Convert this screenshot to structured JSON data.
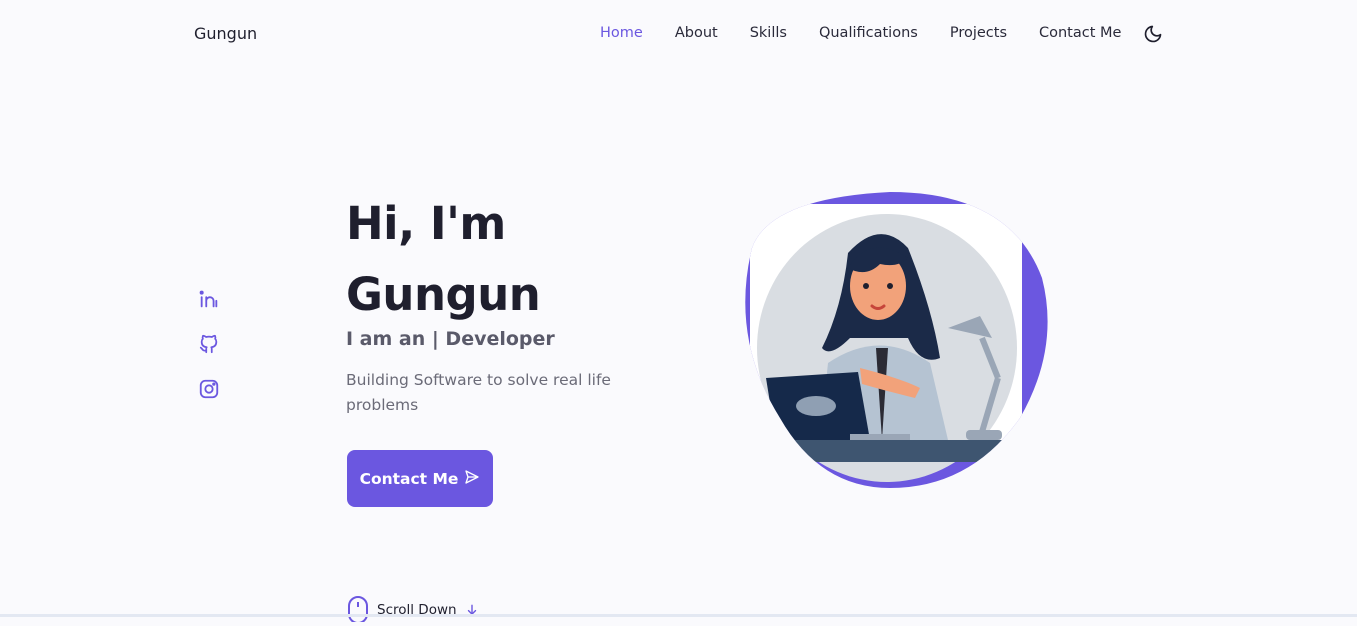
{
  "header": {
    "logo": "Gungun",
    "nav": [
      {
        "label": "Home",
        "active": true
      },
      {
        "label": "About",
        "active": false
      },
      {
        "label": "Skills",
        "active": false
      },
      {
        "label": "Qualifications",
        "active": false
      },
      {
        "label": "Projects",
        "active": false
      },
      {
        "label": "Contact Me",
        "active": false
      }
    ],
    "theme_icon": "moon-icon"
  },
  "socials": [
    {
      "icon": "linkedin-icon"
    },
    {
      "icon": "github-icon"
    },
    {
      "icon": "instagram-icon"
    }
  ],
  "hero": {
    "title_line1": "Hi, I'm",
    "title_line2": "Gungun",
    "subtitle": "I am an | Developer",
    "description": "Building Software to solve real life problems",
    "cta_label": "Contact Me",
    "cta_icon": "send-icon"
  },
  "scroll": {
    "label": "Scroll Down",
    "icon": "mouse-icon",
    "arrow_icon": "arrow-down-icon"
  },
  "colors": {
    "accent": "#6b57e0",
    "background": "#fafafd",
    "text": "#1f1f2e",
    "muted": "#6b6b78"
  }
}
